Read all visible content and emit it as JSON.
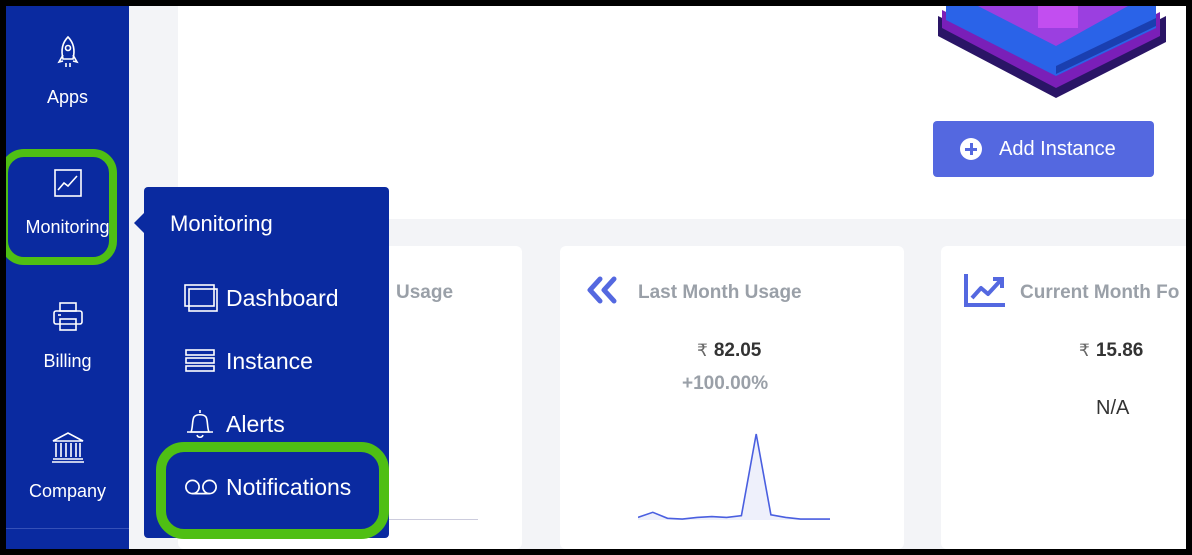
{
  "sidebar": {
    "items": [
      {
        "label": "Apps",
        "icon": "rocket-icon"
      },
      {
        "label": "Monitoring",
        "icon": "chart-icon"
      },
      {
        "label": "Billing",
        "icon": "printer-icon"
      },
      {
        "label": "Company",
        "icon": "bank-icon"
      }
    ]
  },
  "hero": {
    "add_instance_label": "Add Instance"
  },
  "cards": {
    "current_usage": {
      "title_partial": "Usage"
    },
    "last_month": {
      "title": "Last Month Usage",
      "currency": "₹",
      "amount": "82.05",
      "change": "+100.00%"
    },
    "forecast": {
      "title": "Current Month Fo",
      "currency": "₹",
      "amount": "15.86",
      "status": "N/A"
    }
  },
  "flyout": {
    "title": "Monitoring",
    "items": [
      {
        "label": "Dashboard",
        "icon": "dashboard-icon"
      },
      {
        "label": "Instance",
        "icon": "list-icon"
      },
      {
        "label": "Alerts",
        "icon": "bell-icon"
      },
      {
        "label": "Notifications",
        "icon": "voicemail-icon"
      }
    ]
  },
  "colors": {
    "sidebar": "#0a2aa0",
    "accent": "#5468e0",
    "highlight": "#4fbf14"
  },
  "chart_data": {
    "type": "line",
    "values": [
      0.3,
      0.9,
      0.2,
      0.1,
      0.3,
      0.4,
      0.3,
      0.5,
      10,
      0.6,
      0.3,
      0.1,
      0.1,
      0.1
    ]
  }
}
